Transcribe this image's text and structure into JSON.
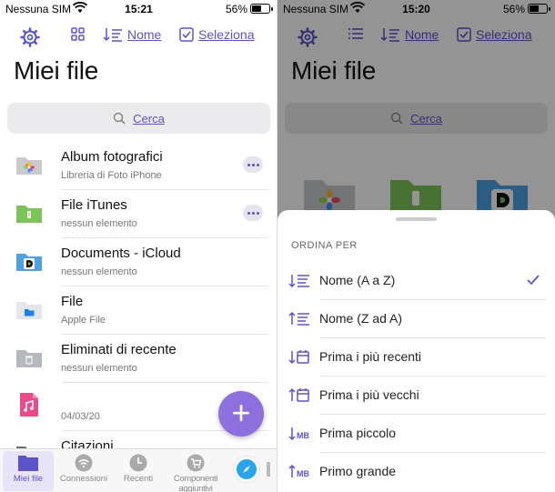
{
  "colors": {
    "accent": "#5b53c8",
    "fab": "#8e6fde",
    "folder_gray": "#c9cacd",
    "folder_green": "#7cc35a",
    "folder_blue": "#4fa1e0"
  },
  "left": {
    "status": {
      "carrier": "Nessuna SIM",
      "time": "15:21",
      "battery": "56%"
    },
    "toolbar": {
      "sort_label": "Nome",
      "select_label": "Seleziona"
    },
    "title": "Miei file",
    "search_placeholder": "Cerca",
    "files": [
      {
        "name": "Album fotografici",
        "sub": "Libreria di Foto iPhone",
        "icon": "photos-folder-icon"
      },
      {
        "name": "File iTunes",
        "sub": "nessun elemento",
        "icon": "itunes-folder-icon"
      },
      {
        "name": "Documents - iCloud",
        "sub": "nessun elemento",
        "icon": "icloud-folder-icon"
      },
      {
        "name": "File",
        "sub": "Apple File",
        "icon": "files-folder-icon"
      },
      {
        "name": "Eliminati di recente",
        "sub": "nessun elemento",
        "icon": "trash-folder-icon"
      },
      {
        "name": "",
        "sub": "04/03/20",
        "icon": "music-file-icon"
      },
      {
        "name": "Citazioni",
        "sub": "",
        "icon": "folder-icon"
      }
    ],
    "fab_label": "+",
    "tabs": [
      {
        "label": "Miei file",
        "icon": "folder-icon"
      },
      {
        "label": "Connessioni",
        "icon": "wifi-icon"
      },
      {
        "label": "Recenti",
        "icon": "clock-icon"
      },
      {
        "label": "Componenti aggiuntivi",
        "icon": "cart-icon"
      }
    ]
  },
  "right": {
    "status": {
      "carrier": "Nessuna SIM",
      "time": "15:20",
      "battery": "56%"
    },
    "toolbar": {
      "sort_label": "Nome",
      "select_label": "Seleziona"
    },
    "title": "Miei file",
    "search_placeholder": "Cerca",
    "sheet": {
      "heading": "ORDINA PER",
      "options": [
        {
          "label": "Nome (A a Z)",
          "selected": true
        },
        {
          "label": "Nome (Z ad A)",
          "selected": false
        },
        {
          "label": "Prima i più recenti",
          "selected": false
        },
        {
          "label": "Prima i più vecchi",
          "selected": false
        },
        {
          "label": "Prima piccolo",
          "selected": false
        },
        {
          "label": "Primo grande",
          "selected": false
        }
      ]
    }
  }
}
